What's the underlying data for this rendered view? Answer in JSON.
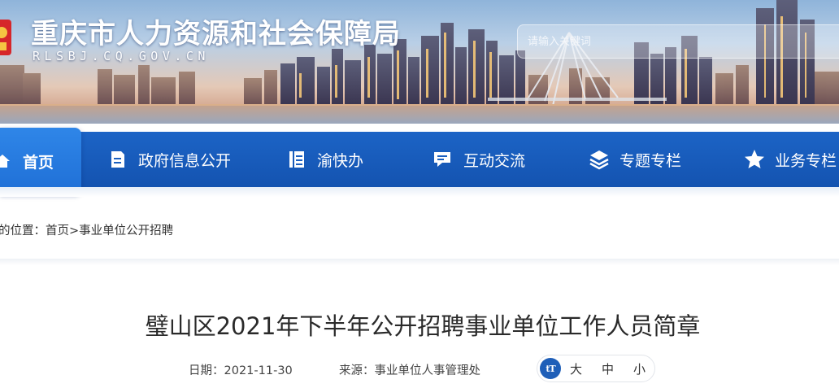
{
  "header": {
    "title": "重庆市人力资源和社会保障局",
    "domain": "RLSBJ.CQ.GOV.CN",
    "search_placeholder": "请输入关键词"
  },
  "nav": {
    "items": [
      {
        "label": "首页",
        "icon": "home-icon",
        "active": true
      },
      {
        "label": "政府信息公开",
        "icon": "document-icon",
        "active": false
      },
      {
        "label": "渝快办",
        "icon": "list-book-icon",
        "active": false
      },
      {
        "label": "互动交流",
        "icon": "chat-icon",
        "active": false
      },
      {
        "label": "专题专栏",
        "icon": "layers-icon",
        "active": false
      },
      {
        "label": "业务专栏",
        "icon": "star-icon",
        "active": false
      }
    ]
  },
  "breadcrumb": {
    "prefix": "的位置：",
    "home": "首页",
    "separator": ">",
    "current": "事业单位公开招聘"
  },
  "article": {
    "title": "璧山区2021年下半年公开招聘事业单位工作人员简章",
    "date_label": "日期：",
    "date": "2021-11-30",
    "source_label": "来源：",
    "source": "事业单位人事管理处",
    "font_icon_text": "tT",
    "font_sizes": [
      "大",
      "中",
      "小"
    ]
  },
  "colors": {
    "nav_blue": "#1a5fc0",
    "nav_active": "#2a7fe3",
    "title_text": "#2a2a2a"
  }
}
